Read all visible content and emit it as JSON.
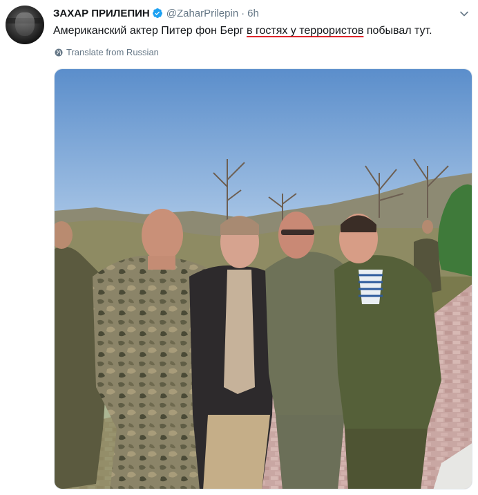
{
  "tweet": {
    "author_name": "ЗАХАР ПРИЛЕПИН",
    "handle": "@ZaharPrilepin",
    "separator": "·",
    "time": "6h",
    "text_before": "Американский актер Питер фон Берг ",
    "text_underlined": "в гостях у террористов",
    "text_after": " побывал тут.",
    "translate_label": "Translate from Russian"
  },
  "icons": {
    "verified": "verified-badge-icon",
    "caret": "chevron-down-icon",
    "globe": "globe-icon"
  },
  "colors": {
    "verified": "#1da1f2",
    "underline": "#e0242a",
    "secondary_text": "#657786",
    "primary_text": "#14171a"
  }
}
